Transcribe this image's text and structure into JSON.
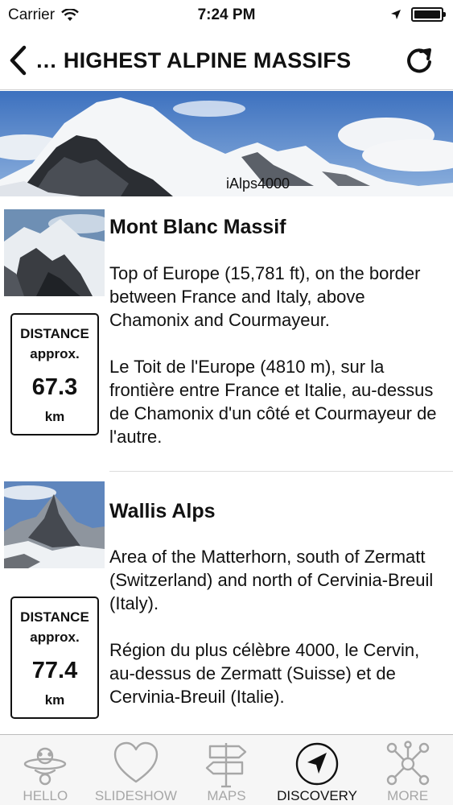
{
  "status_bar": {
    "carrier": "Carrier",
    "time": "7:24 PM"
  },
  "nav": {
    "title": "… HIGHEST ALPINE MASSIFS"
  },
  "banner": {
    "caption": "iAlps4000"
  },
  "entries": [
    {
      "title": "Mont Blanc Massif",
      "distance_label": "DISTANCE",
      "distance_approx": "approx.",
      "distance_value": "67.3",
      "distance_unit": "km",
      "text_en": "Top of Europe (15,781 ft), on the border between France and Italy, above Chamonix and Courmayeur.",
      "text_fr": "Le Toit de l'Europe (4810 m), sur la frontière entre France et Italie, au-dessus de Chamonix d'un côté et Courmayeur de l'autre."
    },
    {
      "title": "Wallis Alps",
      "distance_label": "DISTANCE",
      "distance_approx": "approx.",
      "distance_value": "77.4",
      "distance_unit": "km",
      "text_en": "Area of the Matterhorn, south of Zermatt (Switzerland) and north of Cervinia-Breuil (Italy).",
      "text_fr": "Région du plus célèbre 4000, le Cervin, au-dessus de Zermatt (Suisse) et de Cervinia-Breuil (Italie)."
    }
  ],
  "tabs": [
    {
      "label": "HELLO",
      "icon": "hello-icon",
      "active": false
    },
    {
      "label": "SLIDESHOW",
      "icon": "heart-icon",
      "active": false
    },
    {
      "label": "MAPS",
      "icon": "signpost-icon",
      "active": false
    },
    {
      "label": "DISCOVERY",
      "icon": "compass-arrow-icon",
      "active": true
    },
    {
      "label": "MORE",
      "icon": "network-icon",
      "active": false
    }
  ],
  "colors": {
    "tab_inactive": "#a7a7a7",
    "tab_active": "#111111",
    "sky": "#4a7fc9"
  }
}
